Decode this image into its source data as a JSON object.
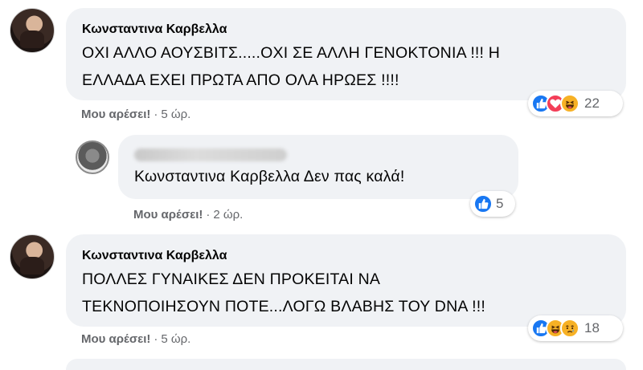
{
  "comments": [
    {
      "author": "Κωνσταντινα Καρβελλα",
      "lines": [
        "ΟΧΙ ΑΛΛΟ ΑΟΥΣΒΙΤΣ.....ΟΧΙ ΣΕ ΑΛΛΗ ΓΕΝΟΚΤΟΝΙΑ !!! Η",
        "ΕΛΛΑΔΑ ΕΧΕΙ ΠΡΩΤΑ ΑΠΟ ΟΛΑ ΗΡΩΕΣ !!!!"
      ],
      "like_label": "Μου αρέσει!",
      "separator": "·",
      "time": "5 ώρ.",
      "reactions": [
        "like-icon",
        "love-icon",
        "haha-icon"
      ],
      "reaction_count": "22"
    },
    {
      "author_hidden": true,
      "lines": [
        "Κωνσταντινα Καρβελλα Δεν πας καλά!"
      ],
      "like_label": "Μου αρέσει!",
      "separator": "·",
      "time": "2 ώρ.",
      "reactions": [
        "like-icon"
      ],
      "reaction_count": "5"
    },
    {
      "author": "Κωνσταντινα Καρβελλα",
      "lines": [
        "ΠΟΛΛΕΣ ΓΥΝΑΙΚΕΣ ΔΕΝ ΠΡΟΚΕΙΤΑΙ ΝΑ",
        "ΤΕΚΝΟΠΟΙΗΣΟΥΝ ΠΟΤΕ...ΛΟΓΩ ΒΛΑΒΗΣ ΤΟΥ DNA !!!"
      ],
      "like_label": "Μου αρέσει!",
      "separator": "·",
      "time": "5 ώρ.",
      "reactions": [
        "like-icon",
        "haha-icon",
        "sad-icon"
      ],
      "reaction_count": "18"
    }
  ],
  "colors": {
    "bubble": "#f0f2f5",
    "like": "#1877f2",
    "love": "#f33e58",
    "haha": "#f7b125",
    "meta_text": "#65676b"
  }
}
